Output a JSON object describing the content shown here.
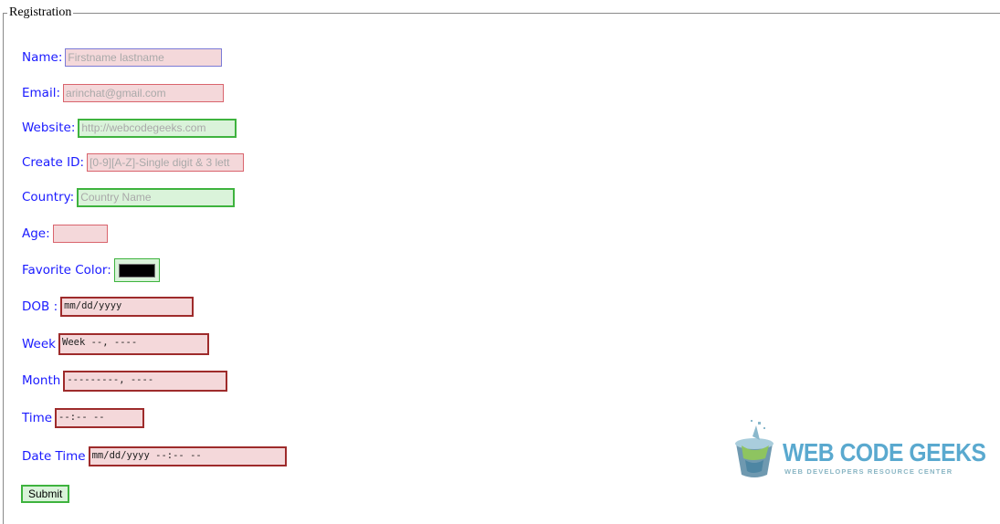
{
  "form": {
    "legend": "Registration",
    "fields": {
      "name": {
        "label": "Name:",
        "placeholder": "Firstname lastname",
        "state": "focused"
      },
      "email": {
        "label": "Email:",
        "placeholder": "arinchat@gmail.com",
        "state": "invalid"
      },
      "website": {
        "label": "Website:",
        "placeholder": "http://webcodegeeks.com",
        "state": "valid"
      },
      "create_id": {
        "label": "Create ID:",
        "placeholder": "[0-9][A-Z]-Single digit & 3 lett",
        "state": "invalid"
      },
      "country": {
        "label": "Country:",
        "placeholder": "Country Name",
        "state": "valid"
      },
      "age": {
        "label": "Age:",
        "placeholder": "",
        "state": "invalid"
      },
      "favorite_color": {
        "label": "Favorite Color:",
        "value": "#000000",
        "state": "valid"
      },
      "dob": {
        "label": "DOB :",
        "value": "mm/dd/yyyy",
        "state": "invalid"
      },
      "week": {
        "label": "Week",
        "value": "Week --, ----",
        "state": "invalid"
      },
      "month": {
        "label": "Month",
        "value": "---------, ----",
        "state": "invalid"
      },
      "time": {
        "label": "Time",
        "value": "--:-- --",
        "state": "invalid"
      },
      "date_time": {
        "label": "Date Time",
        "value": "mm/dd/yyyy --:-- --",
        "state": "invalid"
      }
    },
    "submit_label": "Submit"
  },
  "logo": {
    "title": "WEB CODE GEEKS",
    "subtitle": "WEB DEVELOPERS RESOURCE CENTER"
  },
  "colors": {
    "label": "#1a1aff",
    "invalid_bg": "#f4d8da",
    "invalid_border": "#d9646d",
    "valid_bg": "#daf3da",
    "valid_border": "#3eb33e"
  }
}
